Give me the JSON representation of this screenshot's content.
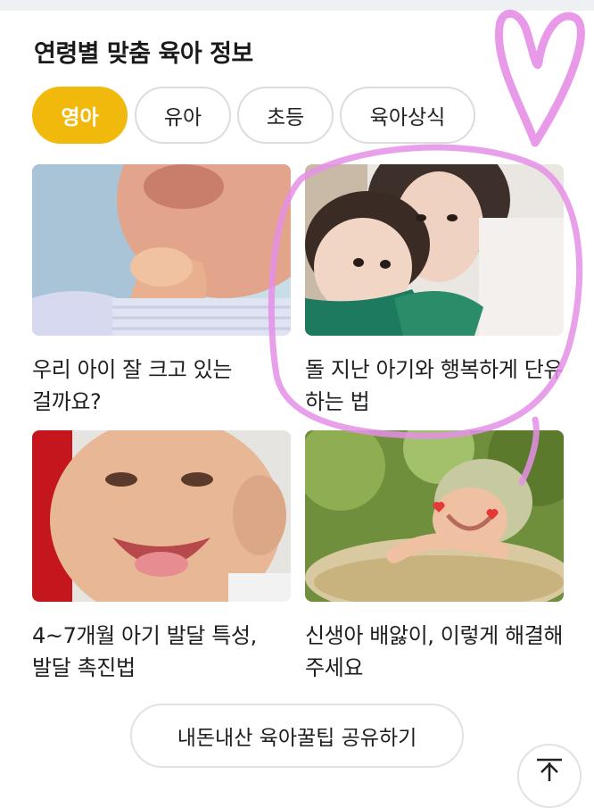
{
  "section": {
    "title": "연령별 맞춤 육아 정보"
  },
  "tabs": [
    {
      "label": "영아",
      "active": true
    },
    {
      "label": "유아",
      "active": false
    },
    {
      "label": "초등",
      "active": false
    },
    {
      "label": "육아상식",
      "active": false
    }
  ],
  "cards": [
    {
      "title": "우리 아이 잘 크고 있는 걸까요?",
      "image": "baby-biting-fingers-photo"
    },
    {
      "title": "돌 지난 아기와 행복하게 단유 하는 법",
      "image": "mother-and-toddler-selfie-photo"
    },
    {
      "title": "4~7개월 아기 발달 특성, 발달 촉진법",
      "image": "laughing-baby-photo"
    },
    {
      "title": "신생아 배앓이, 이렇게 해결해 주세요",
      "image": "newborn-crying-in-basket-photo"
    }
  ],
  "share_button": {
    "label": "내돈내산 육아꿀팁 공유하기"
  },
  "scroll_top": {
    "icon": "arrow-up-to-top-icon"
  },
  "colors": {
    "accent": "#f2b90d",
    "annotation": "#e58fe6"
  }
}
